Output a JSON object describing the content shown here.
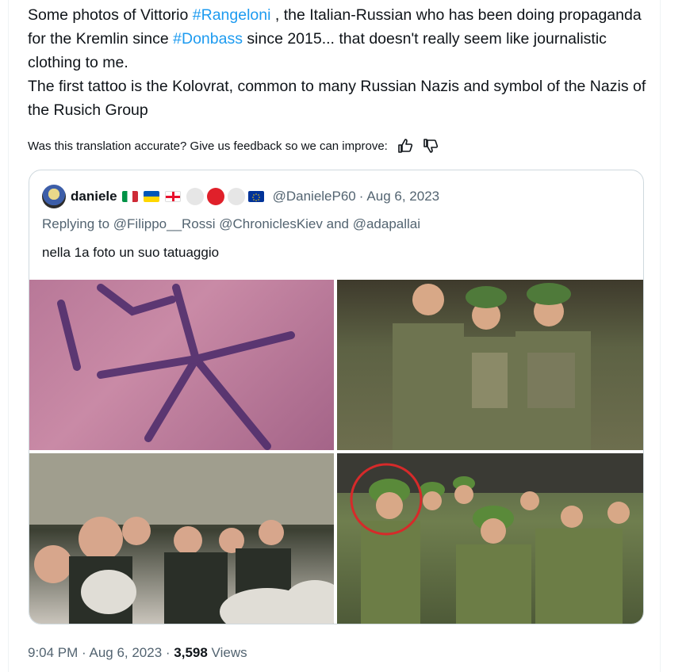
{
  "tweet": {
    "body_parts": [
      {
        "text": "Some photos of Vittorio ",
        "hashtag": false
      },
      {
        "text": "#Rangeloni",
        "hashtag": true
      },
      {
        "text": " , the Italian-Russian who has been doing propaganda for the Kremlin since ",
        "hashtag": false
      },
      {
        "text": "#Donbass",
        "hashtag": true
      },
      {
        "text": " since 2015... that doesn't really seem like journalistic clothing to me.",
        "hashtag": false
      }
    ],
    "body_line2": "The first tattoo is the Kolovrat, common to many Russian Nazis and symbol of the Nazis of the Rusich Group",
    "feedback_text": "Was this translation accurate? Give us feedback so we can improve:",
    "feedback_icons": [
      "thumbs-up-icon",
      "thumbs-down-icon"
    ],
    "timestamp": "9:04 PM · Aug 6, 2023 · ",
    "views_count": "3,598",
    "views_label": " Views"
  },
  "quote": {
    "name": "daniele",
    "handle": "@DanieleP60",
    "separator": "·",
    "date": "Aug 6, 2023",
    "reply_line": "Replying to @Filippo__Rossi @ChroniclesKiev and @adapallai",
    "text": "nella 1a foto un suo tatuaggio",
    "photos": [
      "tattoo-photo",
      "soldiers-group-photo",
      "crowd-seated-photo",
      "soldiers-field-photo"
    ]
  },
  "colors": {
    "link": "#1d9bf0",
    "text": "#0f1419",
    "secondary": "#536471",
    "border": "#cfd9de",
    "circle_highlight": "#d62a2a"
  }
}
